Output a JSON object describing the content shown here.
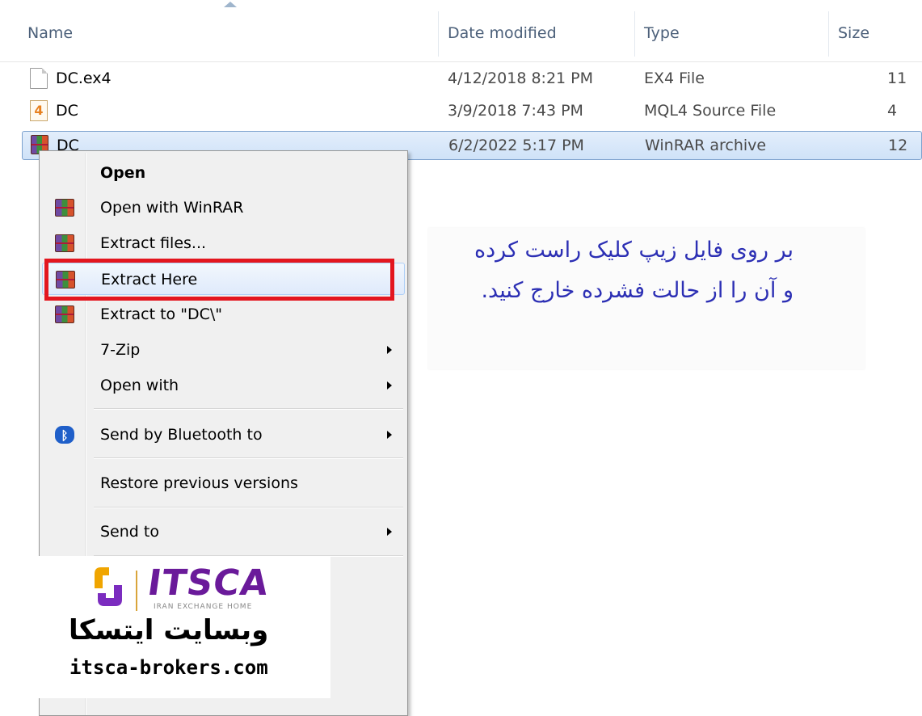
{
  "columns": {
    "name": "Name",
    "date_modified": "Date modified",
    "type": "Type",
    "size": "Size"
  },
  "files": [
    {
      "name": "DC.ex4",
      "date": "4/12/2018 8:21 PM",
      "type": "EX4 File",
      "size": "11",
      "icon": "document-icon"
    },
    {
      "name": "DC",
      "date": "3/9/2018 7:43 PM",
      "type": "MQL4 Source File",
      "size": "4",
      "icon": "mql4-icon"
    },
    {
      "name": "DC",
      "date": "6/2/2022 5:17 PM",
      "type": "WinRAR archive",
      "size": "12",
      "icon": "winrar-icon",
      "selected": true
    }
  ],
  "context_menu": {
    "items": [
      {
        "label": "Open"
      },
      {
        "label": "Open with WinRAR",
        "icon": "winrar-icon"
      },
      {
        "label": "Extract files...",
        "icon": "winrar-icon"
      },
      {
        "label": "Extract Here",
        "icon": "winrar-icon",
        "highlighted": true
      },
      {
        "label": "Extract to \"DC\\\"",
        "icon": "winrar-icon"
      },
      {
        "label": "7-Zip",
        "submenu": true
      },
      {
        "label": "Open with",
        "submenu": true
      },
      {
        "label": "Send by Bluetooth to",
        "icon": "bluetooth-icon",
        "submenu": true
      },
      {
        "label": "Restore previous versions"
      },
      {
        "label": "Send to",
        "submenu": true
      }
    ]
  },
  "note": {
    "line1": "بر روی فایل زیپ کلیک راست کرده",
    "line2": "و آن را از حالت فشرده خارج کنید."
  },
  "watermark": {
    "brand": "ITSCA",
    "tagline": "IRAN EXCHANGE HOME",
    "persian": "وبسایت ایتسکا",
    "url": "itsca-brokers.com"
  },
  "colors": {
    "annotation_box": "#e3161f",
    "note_text": "#2c2fb4",
    "selection": "#cfe2f8",
    "brand_purple": "#6a1a9a"
  }
}
